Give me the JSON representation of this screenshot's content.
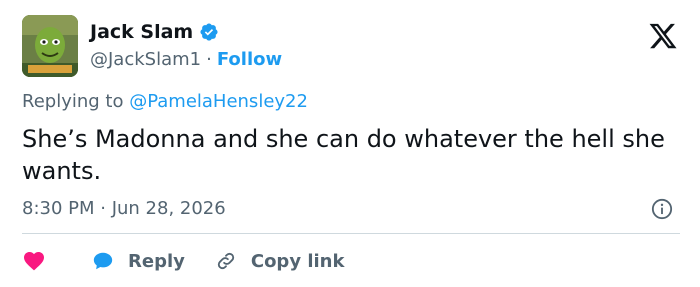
{
  "author": {
    "name": "Jack Slam",
    "handle": "@JackSlam1",
    "separator": "·",
    "follow_label": "Follow"
  },
  "reply_context": {
    "prefix": "Replying to ",
    "mention": "@PamelaHensley22"
  },
  "tweet": {
    "text": "She’s Madonna and she can do whatever the hell she wants.",
    "timestamp": "8:30 PM · Jun 28, 2026"
  },
  "actions": {
    "reply_label": "Reply",
    "copy_link_label": "Copy link"
  },
  "icons": {
    "verified": "verified-badge-icon",
    "brand": "x-logo-icon",
    "info": "info-icon",
    "like": "heart-icon",
    "reply": "speech-bubble-icon",
    "copy_link": "link-icon"
  },
  "colors": {
    "accent": "#1d9bf0",
    "like": "#f91880",
    "text": "#0f1419",
    "muted": "#536471"
  }
}
